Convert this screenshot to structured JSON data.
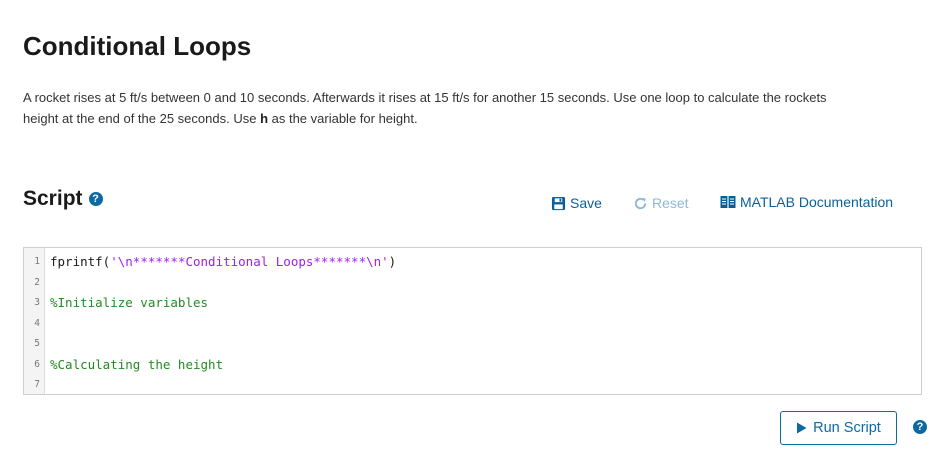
{
  "page": {
    "title": "Conditional Loops",
    "description_before": "A rocket rises at 5 ft/s between 0 and 10 seconds. Afterwards it rises at 15 ft/s for another 15 seconds. Use one loop to calculate the rockets height at the end of the 25 seconds. Use ",
    "description_bold": "h",
    "description_after": " as the variable for height."
  },
  "script_section": {
    "heading": "Script",
    "help_glyph": "?",
    "toolbar": {
      "save_label": "Save",
      "reset_label": "Reset",
      "docs_label": "MATLAB Documentation"
    }
  },
  "editor": {
    "lines": [
      {
        "num": "1",
        "func": "fprintf(",
        "str": "'\\n*******Conditional Loops*******\\n'",
        "end": ")",
        "comment": ""
      },
      {
        "num": "2",
        "func": "",
        "str": "",
        "end": "",
        "comment": ""
      },
      {
        "num": "3",
        "func": "",
        "str": "",
        "end": "",
        "comment": "%Initialize variables"
      },
      {
        "num": "4",
        "func": "",
        "str": "",
        "end": "",
        "comment": ""
      },
      {
        "num": "5",
        "func": "",
        "str": "",
        "end": "",
        "comment": ""
      },
      {
        "num": "6",
        "func": "",
        "str": "",
        "end": "",
        "comment": "%Calculating the height"
      },
      {
        "num": "7",
        "func": "",
        "str": "",
        "end": "",
        "comment": ""
      }
    ]
  },
  "actions": {
    "run_label": "Run Script",
    "help_glyph": "?"
  },
  "colors": {
    "accent": "#0b6aa2",
    "link": "#0b5f99",
    "disabled": "#8fb9d3",
    "string": "#a020f0",
    "comment": "#228b22"
  }
}
